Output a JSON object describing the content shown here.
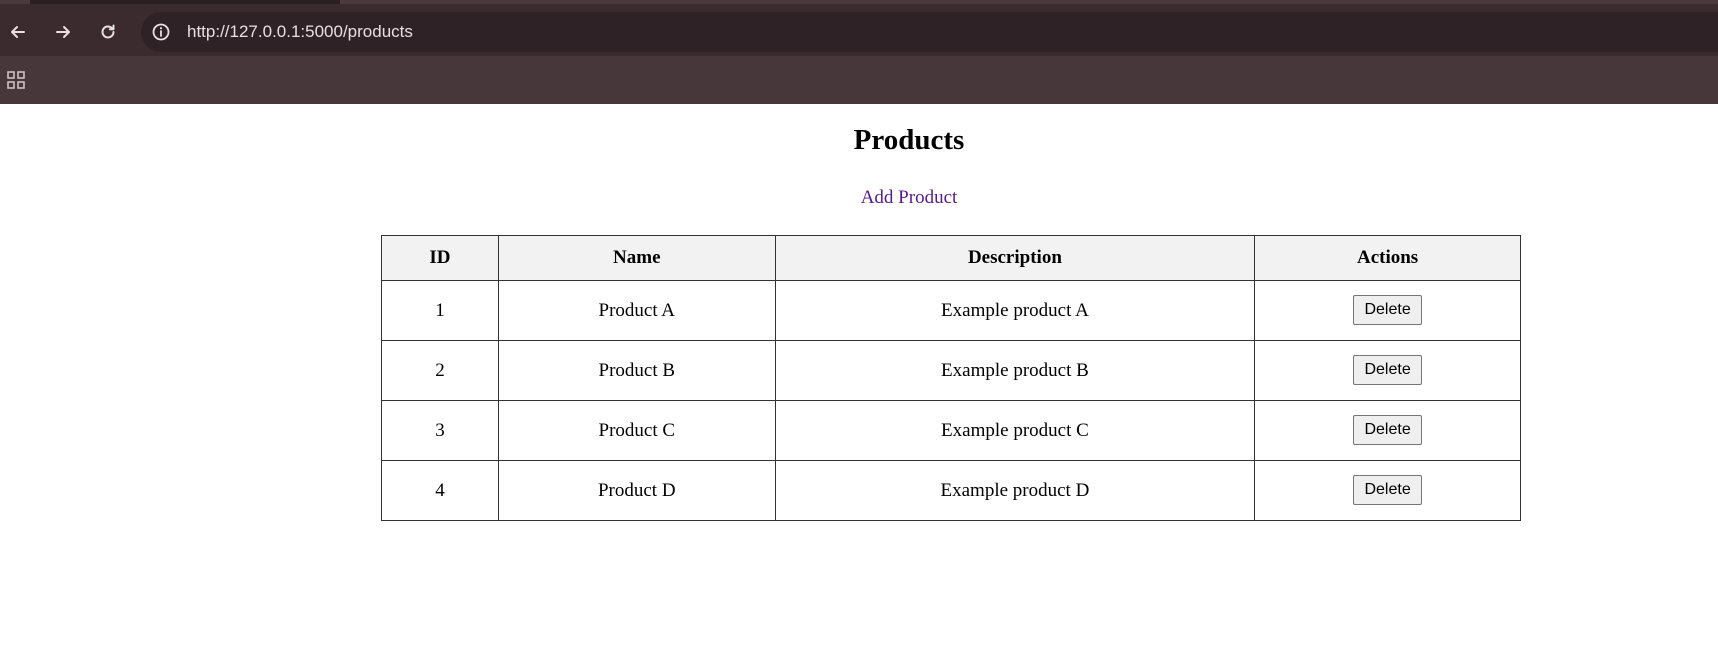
{
  "browser": {
    "url": "http://127.0.0.1:5000/products",
    "icons": {
      "back": "arrow-left-icon",
      "forward": "arrow-right-icon",
      "reload": "reload-icon",
      "site_info": "info-icon",
      "apps": "apps-grid-icon"
    }
  },
  "page": {
    "title": "Products",
    "add_link": "Add Product"
  },
  "table": {
    "headers": [
      "ID",
      "Name",
      "Description",
      "Actions"
    ],
    "rows": [
      {
        "id": "1",
        "name": "Product A",
        "description": "Example product A",
        "action": "Delete"
      },
      {
        "id": "2",
        "name": "Product B",
        "description": "Example product B",
        "action": "Delete"
      },
      {
        "id": "3",
        "name": "Product C",
        "description": "Example product C",
        "action": "Delete"
      },
      {
        "id": "4",
        "name": "Product D",
        "description": "Example product D",
        "action": "Delete"
      }
    ]
  },
  "colors": {
    "chrome_bg": "#3b2b2f",
    "omnibox_bg": "#2f2226",
    "link": "#551a8b",
    "header_bg": "#f2f2f2"
  }
}
